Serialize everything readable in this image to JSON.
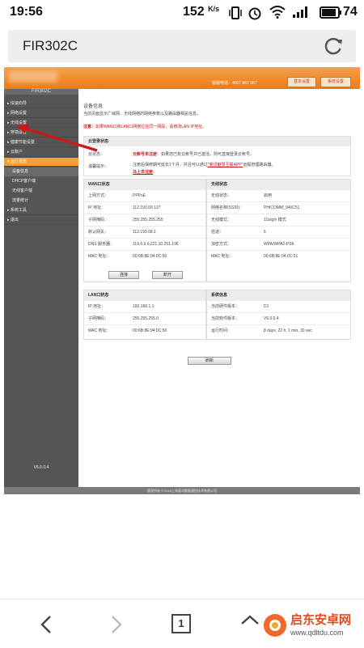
{
  "status_bar": {
    "time": "19:56",
    "speed": "152",
    "speed_unit": "K/s",
    "battery": "74"
  },
  "browser": {
    "url_title": "FIR302C"
  },
  "router": {
    "header": {
      "phone": "客服电话：4007 867 567",
      "basic_settings": "基本设置",
      "system_settings": "系统设置"
    },
    "sidebar": {
      "brand": "FIR302C",
      "items": [
        {
          "label": "▸ 快速向导"
        },
        {
          "label": "▸ 网络设置"
        },
        {
          "label": "▸ 无线设置"
        },
        {
          "label": "▸ 穿墙设置"
        },
        {
          "label": "▸ 健康节能设置"
        },
        {
          "label": "▸ 云账户"
        },
        {
          "label": "▾ 运行状态"
        }
      ],
      "subitems": [
        {
          "label": "设备信息"
        },
        {
          "label": "DHCP客户端"
        },
        {
          "label": "无线客户端"
        },
        {
          "label": "流量统计"
        }
      ],
      "after_items": [
        {
          "label": "▸ 系统工具"
        },
        {
          "label": "▸ 退出"
        }
      ],
      "version": "V6.0.0.4"
    },
    "content": {
      "title": "设备信息",
      "desc": "当前页面显示广域网、无线网络的网络参数以及路由器相关信息。",
      "note_label": "注意：",
      "note_text": "如果WAN口和LAN口网络位在同一网段，请修改LAN IP地址。",
      "cloud": {
        "head": "云登录状态",
        "state_label": "云状态：",
        "state_value": "云帐号未注册",
        "state_desc": "：如果您已有云帐号并已激活，则可直接登录云帐号。",
        "tip_label": "温馨提示：",
        "tip_text": "注册后保修期可延长1个月，并且可以通过",
        "tip_link": "\"斐讯魅慧互联APP\"",
        "tip_tail": "远程管理路由器。",
        "register_link": "马上去注册"
      },
      "wan": {
        "head": "WAN口状态",
        "rows": [
          {
            "label": "上网方式：",
            "value": "PPPoE"
          },
          {
            "label": "IP 地址：",
            "value": "112.193.69.127"
          },
          {
            "label": "子网掩码：",
            "value": "255.255.255.255"
          },
          {
            "label": "默认网关：",
            "value": "112.193.68.1"
          },
          {
            "label": "DNS 服务器：",
            "value": "119.6.6.6,221.10.251.196"
          },
          {
            "label": "MAC 地址：",
            "value": "00:6B:8E:94:0C:50"
          }
        ],
        "connect_btn": "连接",
        "disconnect_btn": "断开"
      },
      "wireless": {
        "head": "无线状态",
        "rows": [
          {
            "label": "无线状态：",
            "value": "启用"
          },
          {
            "label": "网络名称(SSID)：",
            "value": "PHICOMM_940C51"
          },
          {
            "label": "无线模式：",
            "value": "11b/g/n 模式"
          },
          {
            "label": "信道：",
            "value": "6"
          },
          {
            "label": "加密方式：",
            "value": "WPA/WPA2-PSK"
          },
          {
            "label": "MAC 地址：",
            "value": "00:6B:8E:94:0C:51"
          }
        ]
      },
      "lan": {
        "head": "LAN口状态",
        "rows": [
          {
            "label": "IP 地址：",
            "value": "192.168.1.1"
          },
          {
            "label": "子网掩码：",
            "value": "255.255.255.0"
          },
          {
            "label": "MAC 地址：",
            "value": "00:6B:8E:94:0C:50"
          }
        ]
      },
      "system": {
        "head": "系统信息",
        "rows": [
          {
            "label": "当前硬件版本：",
            "value": "D1"
          },
          {
            "label": "当前软件版本：",
            "value": "V6.0.0.4"
          },
          {
            "label": "运行时间：",
            "value": "8 days, 22 h, 1 min, 30 sec"
          }
        ]
      },
      "refresh_btn": "刷新"
    },
    "footer": "版权所有 © 2015上海斐讯数据通信技术有限公司"
  },
  "bottom_nav": {
    "tab_count": "1"
  },
  "watermark": {
    "title": "启东安卓网",
    "url": "www.qdltdu.com"
  },
  "colors": {
    "header_orange": "#ec7a16",
    "active_menu": "#f59f36",
    "sidebar_bg": "#555555",
    "arrow_red": "#cc1a1a"
  }
}
